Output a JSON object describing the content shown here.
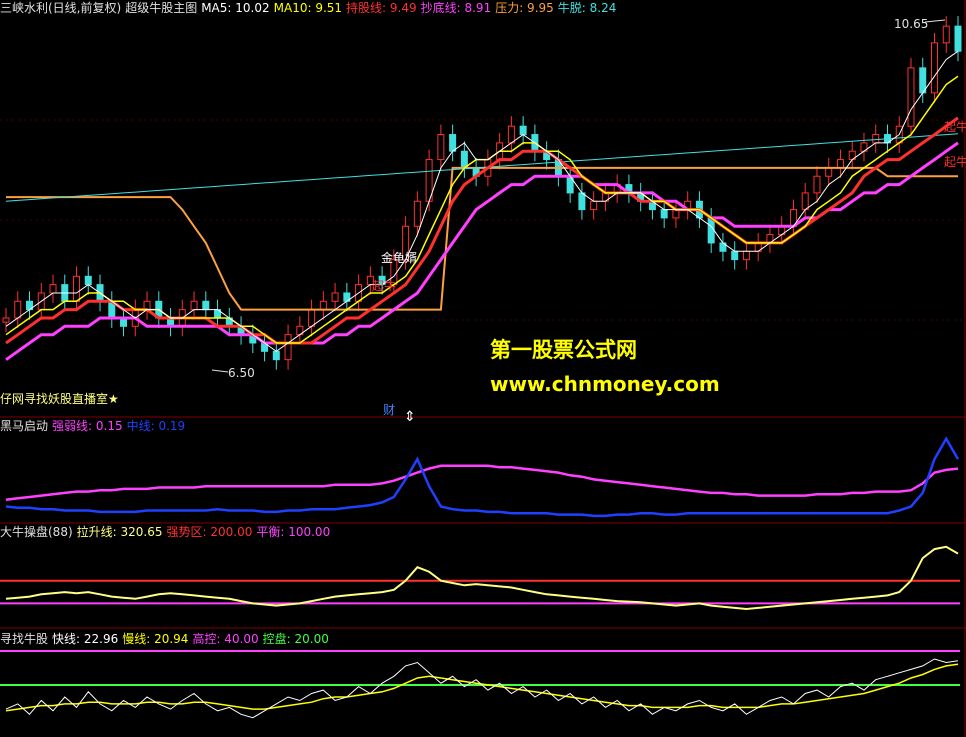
{
  "main_panel": {
    "title": "三峡水利(日线,前复权)",
    "indicator": "超级牛股主图",
    "legend": [
      {
        "label": "MA5: 10.02",
        "color": "#ffffff"
      },
      {
        "label": "MA10: 9.51",
        "color": "#ffff00"
      },
      {
        "label": "持股线: 9.49",
        "color": "#ff3030"
      },
      {
        "label": "抄底线: 8.91",
        "color": "#ff40ff"
      },
      {
        "label": "压力: 9.95",
        "color": "#ffa040"
      },
      {
        "label": "牛脱: 8.24",
        "color": "#40e0e0"
      }
    ],
    "high_label": "10.65",
    "low_label": "6.50",
    "annotation_1": "金龟婿",
    "annotation_2": "起牛",
    "annotation_3": "起牛",
    "bottom_text": "仔网寻找妖股直播室★",
    "cai_label": "财"
  },
  "panel_2": {
    "title": "黑马启动",
    "legend": [
      {
        "label": "强弱线: 0.15",
        "color": "#ff40ff"
      },
      {
        "label": "中线: 0.19",
        "color": "#2040ff"
      }
    ]
  },
  "panel_3": {
    "title": "大牛操盘(88)",
    "legend": [
      {
        "label": "拉升线: 320.65",
        "color": "#ffff80"
      },
      {
        "label": "强势区: 200.00",
        "color": "#ff3030"
      },
      {
        "label": "平衡: 100.00",
        "color": "#ff40ff"
      }
    ]
  },
  "panel_4": {
    "title": "寻找牛股",
    "legend": [
      {
        "label": "快线: 22.96",
        "color": "#ffffff"
      },
      {
        "label": "慢线: 20.94",
        "color": "#ffff00"
      },
      {
        "label": "高控: 40.00",
        "color": "#ff40ff"
      },
      {
        "label": "控盘: 20.00",
        "color": "#40ff40"
      }
    ]
  },
  "watermark": {
    "line1": "第一股票公式网",
    "line2": "www.chnmoney.com"
  },
  "chart_data": {
    "type": "line",
    "price_range": [
      6.5,
      10.65
    ],
    "close": [
      7.1,
      7.3,
      7.2,
      7.4,
      7.5,
      7.3,
      7.6,
      7.5,
      7.3,
      7.1,
      7.0,
      7.2,
      7.3,
      7.1,
      7.0,
      7.2,
      7.3,
      7.2,
      7.1,
      7.0,
      6.9,
      6.8,
      6.7,
      6.6,
      6.9,
      7.0,
      7.2,
      7.3,
      7.4,
      7.3,
      7.5,
      7.6,
      7.5,
      7.8,
      8.2,
      8.5,
      9.0,
      9.3,
      9.1,
      8.9,
      8.8,
      9.0,
      9.2,
      9.4,
      9.3,
      9.1,
      9.0,
      8.8,
      8.6,
      8.4,
      8.5,
      8.6,
      8.7,
      8.6,
      8.5,
      8.4,
      8.3,
      8.4,
      8.5,
      8.3,
      8.0,
      7.9,
      7.8,
      7.9,
      8.0,
      8.1,
      8.2,
      8.4,
      8.6,
      8.8,
      8.9,
      9.0,
      9.1,
      9.2,
      9.3,
      9.2,
      9.4,
      10.1,
      9.8,
      10.4,
      10.6,
      10.3
    ],
    "ma5": [
      7.0,
      7.1,
      7.2,
      7.3,
      7.4,
      7.4,
      7.4,
      7.5,
      7.4,
      7.3,
      7.2,
      7.1,
      7.2,
      7.2,
      7.1,
      7.1,
      7.2,
      7.2,
      7.2,
      7.1,
      7.0,
      6.9,
      6.8,
      6.7,
      6.8,
      6.9,
      7.0,
      7.1,
      7.2,
      7.3,
      7.4,
      7.5,
      7.5,
      7.6,
      7.8,
      8.1,
      8.5,
      8.9,
      9.1,
      9.2,
      9.0,
      9.0,
      9.1,
      9.2,
      9.3,
      9.2,
      9.1,
      9.0,
      8.8,
      8.6,
      8.5,
      8.5,
      8.6,
      8.6,
      8.6,
      8.5,
      8.4,
      8.4,
      8.4,
      8.3,
      8.2,
      8.0,
      7.9,
      7.9,
      7.9,
      8.0,
      8.1,
      8.2,
      8.4,
      8.5,
      8.7,
      8.8,
      9.0,
      9.1,
      9.2,
      9.2,
      9.3,
      9.6,
      9.8,
      10.0,
      10.2,
      10.3
    ],
    "ma10": [
      6.9,
      7.0,
      7.1,
      7.2,
      7.2,
      7.3,
      7.3,
      7.4,
      7.4,
      7.3,
      7.3,
      7.2,
      7.2,
      7.2,
      7.1,
      7.1,
      7.1,
      7.1,
      7.1,
      7.1,
      7.0,
      7.0,
      6.9,
      6.8,
      6.8,
      6.8,
      6.9,
      7.0,
      7.1,
      7.2,
      7.3,
      7.4,
      7.4,
      7.5,
      7.6,
      7.8,
      8.1,
      8.4,
      8.7,
      8.9,
      9.0,
      9.0,
      9.1,
      9.1,
      9.2,
      9.2,
      9.1,
      9.1,
      9.0,
      8.8,
      8.7,
      8.6,
      8.6,
      8.6,
      8.6,
      8.5,
      8.5,
      8.4,
      8.4,
      8.4,
      8.3,
      8.2,
      8.1,
      8.0,
      8.0,
      8.0,
      8.0,
      8.1,
      8.2,
      8.4,
      8.5,
      8.6,
      8.8,
      8.9,
      9.0,
      9.1,
      9.2,
      9.3,
      9.5,
      9.7,
      9.9,
      10.0
    ],
    "hold_line": [
      6.8,
      6.9,
      7.0,
      7.1,
      7.1,
      7.2,
      7.2,
      7.3,
      7.3,
      7.3,
      7.2,
      7.2,
      7.2,
      7.1,
      7.1,
      7.1,
      7.1,
      7.1,
      7.0,
      7.0,
      7.0,
      6.9,
      6.9,
      6.8,
      6.8,
      6.8,
      6.8,
      6.9,
      7.0,
      7.1,
      7.1,
      7.2,
      7.3,
      7.4,
      7.5,
      7.7,
      7.9,
      8.2,
      8.5,
      8.7,
      8.8,
      8.9,
      9.0,
      9.0,
      9.1,
      9.1,
      9.1,
      9.0,
      8.9,
      8.8,
      8.7,
      8.6,
      8.6,
      8.6,
      8.5,
      8.5,
      8.5,
      8.4,
      8.4,
      8.4,
      8.3,
      8.2,
      8.1,
      8.0,
      8.0,
      8.0,
      8.0,
      8.1,
      8.2,
      8.3,
      8.4,
      8.5,
      8.6,
      8.8,
      8.9,
      9.0,
      9.0,
      9.1,
      9.2,
      9.3,
      9.4,
      9.5
    ],
    "bottom_line": [
      6.6,
      6.7,
      6.8,
      6.9,
      6.9,
      7.0,
      7.0,
      7.0,
      7.1,
      7.1,
      7.1,
      7.1,
      7.0,
      7.0,
      7.0,
      7.0,
      7.0,
      7.0,
      7.0,
      6.9,
      6.9,
      6.9,
      6.8,
      6.8,
      6.8,
      6.8,
      6.8,
      6.8,
      6.9,
      6.9,
      7.0,
      7.0,
      7.1,
      7.2,
      7.3,
      7.4,
      7.6,
      7.8,
      8.0,
      8.2,
      8.4,
      8.5,
      8.6,
      8.7,
      8.7,
      8.8,
      8.8,
      8.8,
      8.8,
      8.8,
      8.7,
      8.7,
      8.7,
      8.6,
      8.6,
      8.6,
      8.5,
      8.5,
      8.4,
      8.4,
      8.3,
      8.3,
      8.2,
      8.2,
      8.2,
      8.2,
      8.2,
      8.2,
      8.3,
      8.3,
      8.4,
      8.4,
      8.5,
      8.6,
      8.6,
      8.7,
      8.7,
      8.8,
      8.9,
      9.0,
      9.1,
      9.2
    ],
    "pressure": [
      8.55,
      8.55,
      8.55,
      8.55,
      8.55,
      8.55,
      8.55,
      8.55,
      8.55,
      8.55,
      8.55,
      8.55,
      8.55,
      8.55,
      8.55,
      8.4,
      8.2,
      8.0,
      7.7,
      7.4,
      7.2,
      7.2,
      7.2,
      7.2,
      7.2,
      7.2,
      7.2,
      7.2,
      7.2,
      7.2,
      7.2,
      7.2,
      7.2,
      7.2,
      7.2,
      7.2,
      7.2,
      7.2,
      8.9,
      8.9,
      8.9,
      8.9,
      8.9,
      8.9,
      8.9,
      8.9,
      8.9,
      8.9,
      8.9,
      8.9,
      8.9,
      8.9,
      8.9,
      8.9,
      8.9,
      8.9,
      8.9,
      8.9,
      8.9,
      8.9,
      8.9,
      8.9,
      8.9,
      8.9,
      8.9,
      8.9,
      8.9,
      8.9,
      8.9,
      8.9,
      8.9,
      8.9,
      8.9,
      8.9,
      8.9,
      8.8,
      8.8,
      8.8,
      8.8,
      8.8,
      8.8,
      8.8
    ],
    "bull_line": [
      8.5,
      8.51,
      8.52,
      8.53,
      8.54,
      8.55,
      8.56,
      8.57,
      8.58,
      8.59,
      8.6,
      8.61,
      8.62,
      8.63,
      8.64,
      8.65,
      8.66,
      8.67,
      8.68,
      8.69,
      8.7,
      8.71,
      8.72,
      8.73,
      8.74,
      8.75,
      8.76,
      8.77,
      8.78,
      8.79,
      8.8,
      8.81,
      8.82,
      8.83,
      8.84,
      8.85,
      8.86,
      8.87,
      8.88,
      8.89,
      8.9,
      8.91,
      8.92,
      8.93,
      8.94,
      8.95,
      8.96,
      8.97,
      8.98,
      8.99,
      9.0,
      9.01,
      9.02,
      9.03,
      9.04,
      9.05,
      9.06,
      9.07,
      9.08,
      9.09,
      9.1,
      9.11,
      9.12,
      9.13,
      9.14,
      9.15,
      9.16,
      9.17,
      9.18,
      9.19,
      9.2,
      9.21,
      9.22,
      9.23,
      9.24,
      9.25,
      9.26,
      9.27,
      9.28,
      9.29,
      9.3,
      9.31
    ],
    "strength": [
      0.1,
      0.11,
      0.12,
      0.13,
      0.14,
      0.15,
      0.16,
      0.16,
      0.17,
      0.17,
      0.18,
      0.18,
      0.18,
      0.19,
      0.19,
      0.19,
      0.19,
      0.2,
      0.2,
      0.2,
      0.2,
      0.2,
      0.2,
      0.2,
      0.2,
      0.2,
      0.2,
      0.2,
      0.21,
      0.21,
      0.21,
      0.21,
      0.22,
      0.24,
      0.27,
      0.3,
      0.33,
      0.35,
      0.35,
      0.35,
      0.35,
      0.35,
      0.34,
      0.34,
      0.33,
      0.32,
      0.31,
      0.3,
      0.28,
      0.27,
      0.25,
      0.24,
      0.23,
      0.22,
      0.21,
      0.2,
      0.19,
      0.18,
      0.17,
      0.16,
      0.15,
      0.15,
      0.14,
      0.14,
      0.13,
      0.13,
      0.13,
      0.13,
      0.13,
      0.14,
      0.14,
      0.14,
      0.15,
      0.15,
      0.16,
      0.16,
      0.16,
      0.17,
      0.22,
      0.3,
      0.32,
      0.33
    ],
    "mid": [
      0.05,
      0.04,
      0.04,
      0.03,
      0.03,
      0.02,
      0.02,
      0.02,
      0.01,
      0.01,
      0.01,
      0.01,
      0.02,
      0.02,
      0.02,
      0.02,
      0.02,
      0.02,
      0.03,
      0.02,
      0.02,
      0.02,
      0.01,
      0.01,
      0.02,
      0.02,
      0.03,
      0.03,
      0.03,
      0.04,
      0.05,
      0.06,
      0.08,
      0.12,
      0.25,
      0.4,
      0.2,
      0.05,
      0.03,
      0.02,
      0.02,
      0.01,
      0.01,
      0.0,
      0.0,
      0.0,
      0.0,
      -0.01,
      -0.01,
      -0.01,
      -0.02,
      -0.02,
      -0.01,
      -0.01,
      0.0,
      0.0,
      -0.01,
      -0.01,
      0.0,
      0.0,
      0.0,
      0.0,
      0.0,
      0.0,
      0.0,
      0.0,
      0.0,
      0.0,
      0.0,
      0.0,
      0.0,
      0.0,
      0.0,
      0.0,
      0.0,
      0.0,
      0.02,
      0.05,
      0.15,
      0.4,
      0.55,
      0.4
    ],
    "pull_up": [
      120,
      125,
      130,
      140,
      145,
      150,
      145,
      150,
      140,
      130,
      125,
      120,
      130,
      140,
      145,
      140,
      135,
      130,
      125,
      120,
      110,
      100,
      95,
      90,
      95,
      100,
      110,
      120,
      130,
      135,
      140,
      145,
      150,
      160,
      200,
      260,
      240,
      200,
      190,
      180,
      185,
      180,
      175,
      170,
      160,
      150,
      140,
      135,
      130,
      125,
      120,
      115,
      110,
      108,
      105,
      100,
      95,
      90,
      95,
      100,
      90,
      85,
      80,
      75,
      80,
      85,
      90,
      95,
      100,
      105,
      110,
      115,
      120,
      125,
      130,
      135,
      150,
      200,
      300,
      340,
      350,
      320
    ],
    "strong_zone": 200,
    "balance": 100,
    "fast": [
      15,
      18,
      12,
      20,
      14,
      22,
      16,
      25,
      18,
      14,
      20,
      16,
      22,
      18,
      15,
      20,
      24,
      18,
      14,
      16,
      12,
      10,
      14,
      18,
      22,
      20,
      24,
      26,
      20,
      22,
      28,
      24,
      30,
      34,
      40,
      42,
      36,
      30,
      34,
      28,
      32,
      26,
      30,
      24,
      28,
      22,
      26,
      20,
      24,
      18,
      22,
      16,
      20,
      14,
      18,
      12,
      16,
      14,
      18,
      20,
      16,
      14,
      18,
      12,
      16,
      20,
      22,
      18,
      24,
      26,
      22,
      28,
      30,
      26,
      32,
      34,
      36,
      38,
      40,
      44,
      42,
      43
    ],
    "slow": [
      14,
      15,
      16,
      17,
      17,
      18,
      18,
      19,
      19,
      18,
      18,
      18,
      19,
      19,
      18,
      18,
      19,
      19,
      18,
      17,
      16,
      15,
      15,
      16,
      17,
      18,
      19,
      21,
      22,
      22,
      23,
      24,
      25,
      27,
      30,
      33,
      34,
      33,
      32,
      31,
      30,
      29,
      28,
      27,
      26,
      25,
      24,
      23,
      22,
      21,
      20,
      19,
      18,
      17,
      17,
      16,
      16,
      16,
      16,
      17,
      17,
      16,
      16,
      16,
      16,
      17,
      18,
      18,
      19,
      20,
      21,
      22,
      23,
      24,
      26,
      28,
      30,
      33,
      35,
      38,
      40,
      41
    ],
    "high_control": 40,
    "control": 20
  }
}
